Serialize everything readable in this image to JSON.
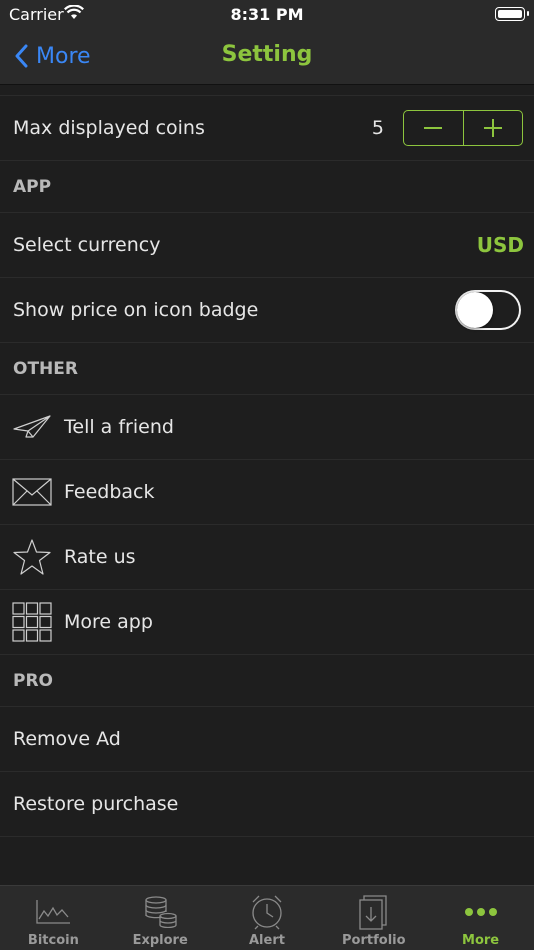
{
  "status_bar": {
    "carrier": "Carrier",
    "time": "8:31 PM"
  },
  "nav": {
    "back_label": "More",
    "title": "Setting"
  },
  "display": {
    "max_coins_label": "Max displayed coins",
    "max_coins_value": "5",
    "minus": "−",
    "plus": "+"
  },
  "sections": {
    "app": {
      "header": "APP",
      "currency_label": "Select currency",
      "currency_value": "USD",
      "badge_label": "Show price on icon badge"
    },
    "other": {
      "header": "OTHER",
      "items": [
        "Tell a friend",
        "Feedback",
        "Rate us",
        "More app"
      ]
    },
    "pro": {
      "header": "PRO",
      "items": [
        "Remove Ad",
        "Restore purchase"
      ]
    }
  },
  "tabs": [
    "Bitcoin",
    "Explore",
    "Alert",
    "Portfolio",
    "More"
  ],
  "colors": {
    "accent_green": "#8dc53e",
    "link_blue": "#3a87f5",
    "background": "#1e1e1e"
  },
  "icons": [
    "paper-plane-icon",
    "envelope-icon",
    "star-icon",
    "grid-icon",
    "chart-icon",
    "coins-icon",
    "alarm-icon",
    "portfolio-icon",
    "more-dots-icon"
  ]
}
